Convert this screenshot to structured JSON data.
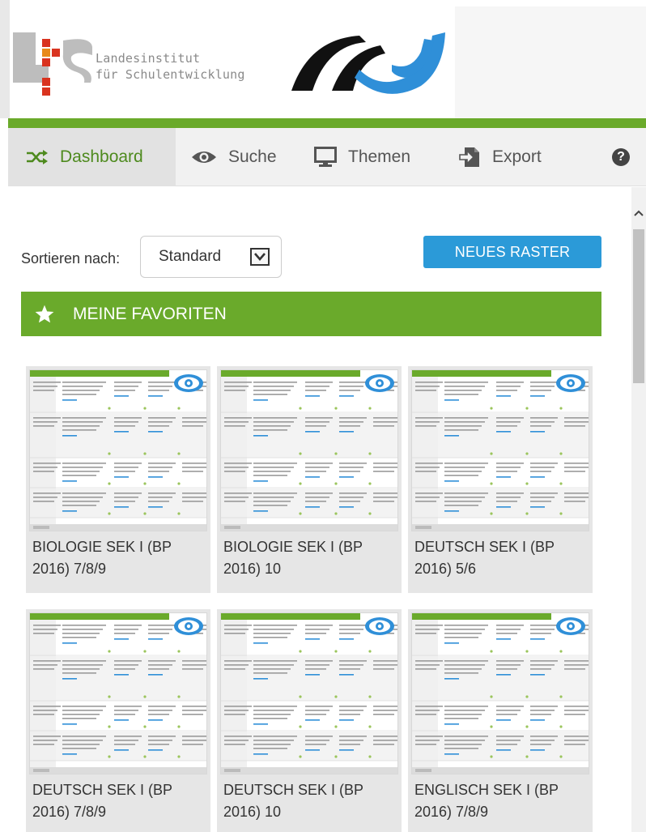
{
  "header": {
    "org_line1": "Landesinstitut",
    "org_line2": "für Schulentwicklung"
  },
  "nav": {
    "items": [
      {
        "label": "Dashboard",
        "icon": "shuffle-icon",
        "active": true
      },
      {
        "label": "Suche",
        "icon": "eye-icon",
        "active": false
      },
      {
        "label": "Themen",
        "icon": "monitor-icon",
        "active": false
      },
      {
        "label": "Export",
        "icon": "export-icon",
        "active": false
      }
    ],
    "help_label": "?"
  },
  "toolbar": {
    "sort_label": "Sortieren nach:",
    "sort_value": "Standard",
    "new_button_label": "NEUES RASTER"
  },
  "favorites": {
    "heading": "MEINE FAVORITEN",
    "cards": [
      {
        "title": "BIOLOGIE SEK I (BP 2016) 7/8/9"
      },
      {
        "title": "BIOLOGIE SEK I (BP 2016) 10"
      },
      {
        "title": "DEUTSCH SEK I (BP 2016) 5/6"
      },
      {
        "title": "DEUTSCH SEK I (BP 2016) 7/8/9"
      },
      {
        "title": "DEUTSCH SEK I (BP 2016) 10"
      },
      {
        "title": "ENGLISCH SEK I (BP 2016) 7/8/9"
      }
    ]
  },
  "colors": {
    "accent_green": "#6aaa2b",
    "button_blue": "#2b9ad8",
    "lis_red": "#d9331f",
    "lis_orange": "#e88a1a",
    "brand_blue": "#2f8fd8"
  }
}
